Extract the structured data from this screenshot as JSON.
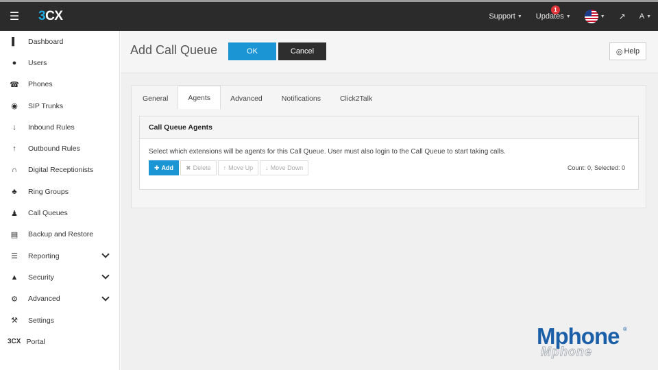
{
  "app": {
    "logo": "3CX"
  },
  "topbar": {
    "menu_icon": "hamburger-icon",
    "support": "Support",
    "updates": "Updates",
    "updates_badge": "1",
    "language_flag": "us-flag-icon",
    "fullscreen_icon": "expand-icon",
    "user": "A"
  },
  "sidebar": {
    "items": [
      {
        "label": "Dashboard",
        "icon": "bar-chart-icon"
      },
      {
        "label": "Users",
        "icon": "user-icon"
      },
      {
        "label": "Phones",
        "icon": "phone-icon"
      },
      {
        "label": "SIP Trunks",
        "icon": "globe-icon"
      },
      {
        "label": "Inbound Rules",
        "icon": "arrow-down-icon"
      },
      {
        "label": "Outbound Rules",
        "icon": "arrow-up-icon"
      },
      {
        "label": "Digital Receptionists",
        "icon": "headset-icon"
      },
      {
        "label": "Ring Groups",
        "icon": "group-icon"
      },
      {
        "label": "Call Queues",
        "icon": "users-icon"
      },
      {
        "label": "Backup and Restore",
        "icon": "database-icon"
      },
      {
        "label": "Reporting",
        "icon": "list-icon"
      },
      {
        "label": "Security",
        "icon": "shield-icon"
      },
      {
        "label": "Advanced",
        "icon": "gear-icon"
      },
      {
        "label": "Settings",
        "icon": "wrench-icon"
      },
      {
        "label": "Portal",
        "icon": "3cx-icon",
        "icon_text": "3CX"
      }
    ]
  },
  "page": {
    "title": "Add Call Queue",
    "ok_label": "OK",
    "cancel_label": "Cancel",
    "help_label": "Help"
  },
  "tabs": [
    {
      "label": "General"
    },
    {
      "label": "Agents",
      "active": true
    },
    {
      "label": "Advanced"
    },
    {
      "label": "Notifications"
    },
    {
      "label": "Click2Talk"
    }
  ],
  "panel": {
    "title": "Call Queue Agents",
    "description": "Select which extensions will be agents for this Call Queue. User must also login to the Call Queue to start taking calls.",
    "add_label": "Add",
    "delete_label": "Delete",
    "move_up_label": "Move Up",
    "move_down_label": "Move Down",
    "count_text": "Count: 0, Selected: 0"
  },
  "brand": {
    "name": "Mphone",
    "reg": "®"
  },
  "colors": {
    "accent": "#1c95d4",
    "topbar": "#2b2b2b",
    "brand": "#1a5fa8"
  }
}
